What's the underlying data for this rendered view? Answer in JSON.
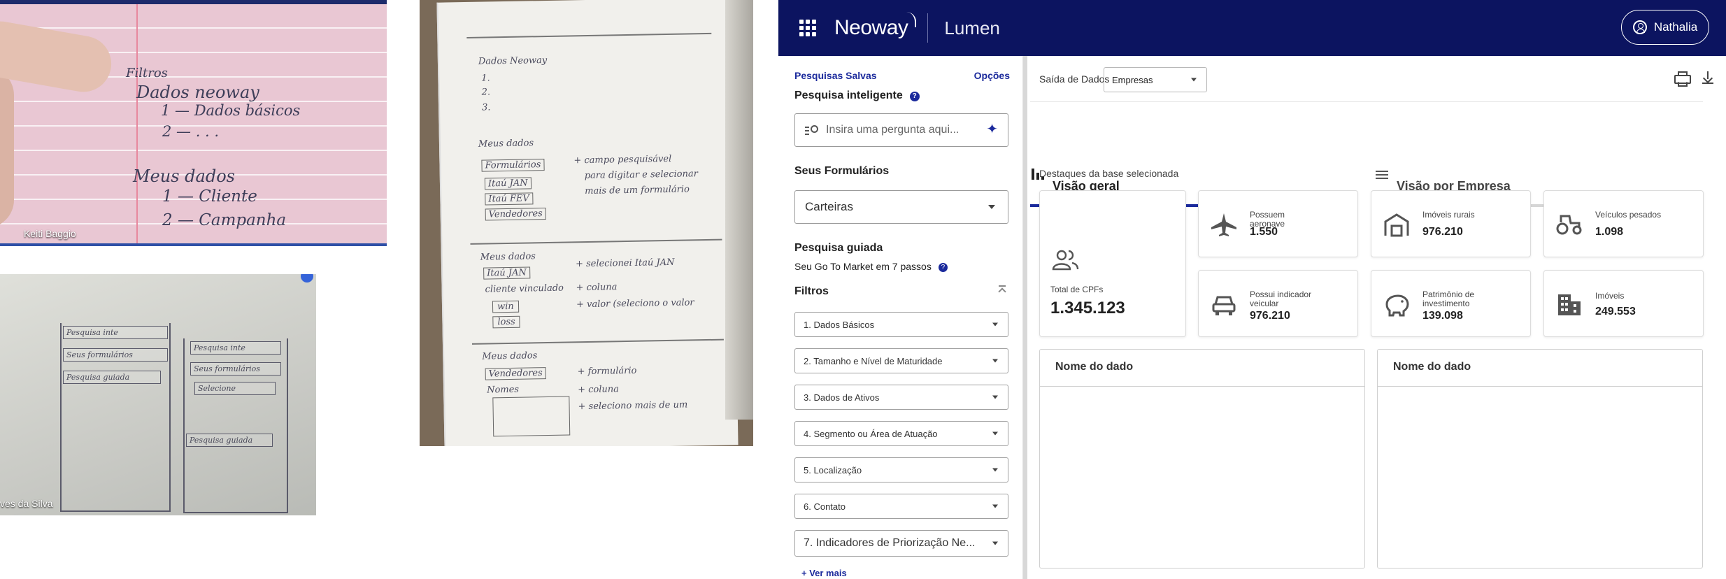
{
  "photos": {
    "tile_1": {
      "caption": "Keiti Baggio",
      "lines": [
        "Filtros",
        "Dados neoway",
        "1 — Dados básicos",
        "2 — . . .",
        "Meus dados",
        "1 — Cliente",
        "2 — Campanha"
      ]
    },
    "tile_2": {
      "caption": "ves da Silva",
      "left_sketch": [
        "Pesquisa inte",
        "Seus formulários",
        "Pesquisa guiada"
      ],
      "right_sketch": [
        "Pesquisa inte",
        "Seus formulários",
        "Selecione",
        "Pesquisa guiada"
      ]
    },
    "notebook": {
      "lines": [
        "Dados Neoway",
        "1.",
        "2.",
        "3.",
        "Meus dados",
        "Formulários",
        "Itaú JAN",
        "Itaú FEV",
        "Vendedores",
        "+ campo pesquisável",
        "para digitar e selecionar",
        "mais de um formulário",
        "Meus dados",
        "Itaú JAN",
        "cliente vinculado",
        "+ coluna",
        "win",
        "loss",
        "+ selecionei Itaú JAN",
        "+ valor (seleciono o valor",
        "Meus dados",
        "Vendedores",
        "+ formulário",
        "Nomes",
        "+ coluna",
        "+ seleciono mais de um"
      ]
    }
  },
  "app": {
    "brand": "Neoway",
    "product": "Lumen",
    "user": "Nathalia",
    "panel": {
      "saved_searches": "Pesquisas Salvas",
      "options": "Opções",
      "smart_search_title": "Pesquisa inteligente",
      "smart_search_placeholder": "Insira uma pergunta aqui...",
      "forms_title": "Seus Formulários",
      "forms_selected": "Carteiras",
      "guided_title": "Pesquisa guiada",
      "guided_subtitle": "Seu Go To Market em 7 passos",
      "filters_title": "Filtros",
      "filters": [
        "1. Dados Básicos",
        "2. Tamanho e Nível de Maturidade",
        "3. Dados de Ativos",
        "4. Segmento ou Área de Atuação",
        "5. Localização",
        "6. Contato",
        "7. Indicadores de Priorização Ne..."
      ],
      "see_more": "+ Ver mais"
    },
    "main": {
      "output_label": "Saída de Dados",
      "output_selected": "Empresas",
      "tabs": [
        "Visão geral",
        "Visão por Empresa"
      ],
      "highlights_title": "Destaques da base selecionada",
      "total": {
        "label": "Total de CPFs",
        "value": "1.345.123"
      },
      "cards": [
        {
          "label": "Possuem aeronave",
          "value": "1.550",
          "icon": "airplane-icon"
        },
        {
          "label": "Imóveis rurais",
          "value": "976.210",
          "icon": "barn-icon"
        },
        {
          "label": "Veículos pesados",
          "value": "1.098",
          "icon": "tractor-icon"
        },
        {
          "label": "Possui indicador veicular",
          "value": "976.210",
          "icon": "car-icon"
        },
        {
          "label": "Patrimônio de investimento",
          "value": "139.098",
          "icon": "piggy-bank-icon"
        },
        {
          "label": "Imóveis",
          "value": "249.553",
          "icon": "building-icon"
        }
      ],
      "tables": [
        "Nome do dado",
        "Nome do dado"
      ]
    },
    "colors": {
      "topbar": "#0c1460",
      "accent": "#1b2a9c"
    }
  }
}
